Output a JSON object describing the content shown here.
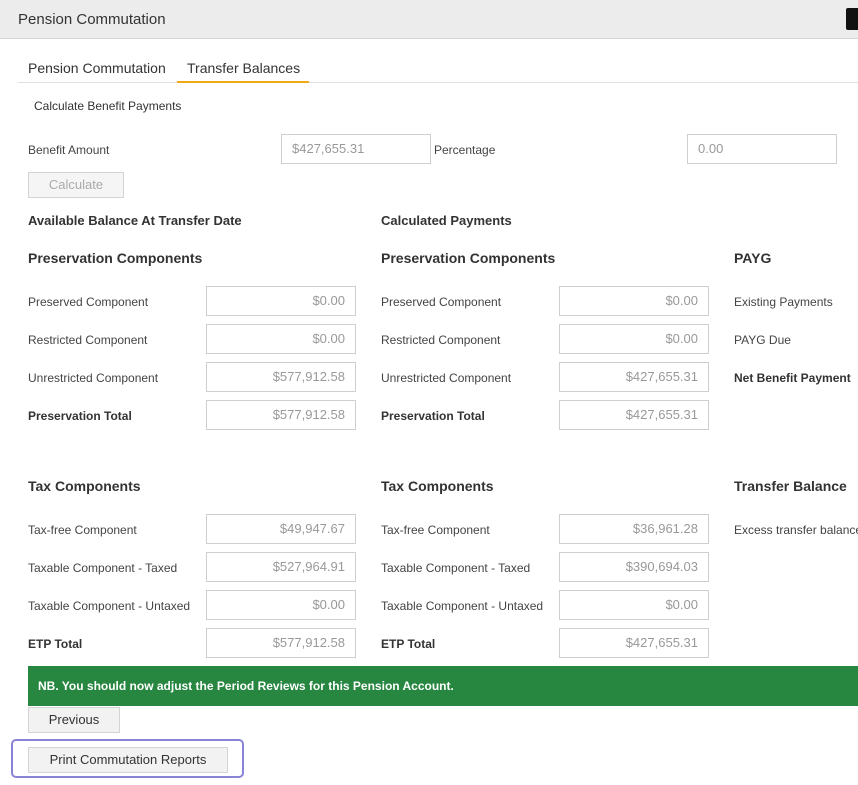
{
  "window": {
    "title": "Pension Commutation"
  },
  "tabs": [
    {
      "label": "Pension Commutation"
    },
    {
      "label": "Transfer Balances"
    }
  ],
  "calculate": {
    "section_title": "Calculate Benefit Payments",
    "benefit_amount_label": "Benefit Amount",
    "benefit_amount_value": "$427,655.31",
    "percentage_label": "Percentage",
    "percentage_value": "0.00",
    "calculate_button": "Calculate"
  },
  "available": {
    "heading": "Available Balance At Transfer Date",
    "preservation": {
      "heading": "Preservation Components",
      "rows": [
        {
          "label": "Preserved Component",
          "value": "$0.00"
        },
        {
          "label": "Restricted Component",
          "value": "$0.00"
        },
        {
          "label": "Unrestricted Component",
          "value": "$577,912.58"
        },
        {
          "label": "Preservation Total",
          "value": "$577,912.58"
        }
      ]
    },
    "tax": {
      "heading": "Tax Components",
      "rows": [
        {
          "label": "Tax-free Component",
          "value": "$49,947.67"
        },
        {
          "label": "Taxable Component - Taxed",
          "value": "$527,964.91"
        },
        {
          "label": "Taxable Component - Untaxed",
          "value": "$0.00"
        },
        {
          "label": "ETP Total",
          "value": "$577,912.58"
        }
      ]
    }
  },
  "calculated": {
    "heading": "Calculated Payments",
    "preservation": {
      "heading": "Preservation Components",
      "rows": [
        {
          "label": "Preserved Component",
          "value": "$0.00"
        },
        {
          "label": "Restricted Component",
          "value": "$0.00"
        },
        {
          "label": "Unrestricted Component",
          "value": "$427,655.31"
        },
        {
          "label": "Preservation Total",
          "value": "$427,655.31"
        }
      ]
    },
    "tax": {
      "heading": "Tax Components",
      "rows": [
        {
          "label": "Tax-free Component",
          "value": "$36,961.28"
        },
        {
          "label": "Taxable Component - Taxed",
          "value": "$390,694.03"
        },
        {
          "label": "Taxable Component - Untaxed",
          "value": "$0.00"
        },
        {
          "label": "ETP Total",
          "value": "$427,655.31"
        }
      ]
    }
  },
  "payg": {
    "heading": "PAYG",
    "rows": [
      {
        "label": "Existing Payments"
      },
      {
        "label": "PAYG Due"
      },
      {
        "label": "Net Benefit Payment"
      }
    ]
  },
  "transfer_balance": {
    "heading": "Transfer Balance",
    "excess_label": "Excess transfer balance"
  },
  "notice": "NB. You should now adjust the Period Reviews for this Pension Account.",
  "buttons": {
    "previous": "Previous",
    "print": "Print Commutation Reports"
  },
  "colors": {
    "accent": "#f0a817",
    "notice_bg": "#278740",
    "highlight": "#8a84d6"
  }
}
